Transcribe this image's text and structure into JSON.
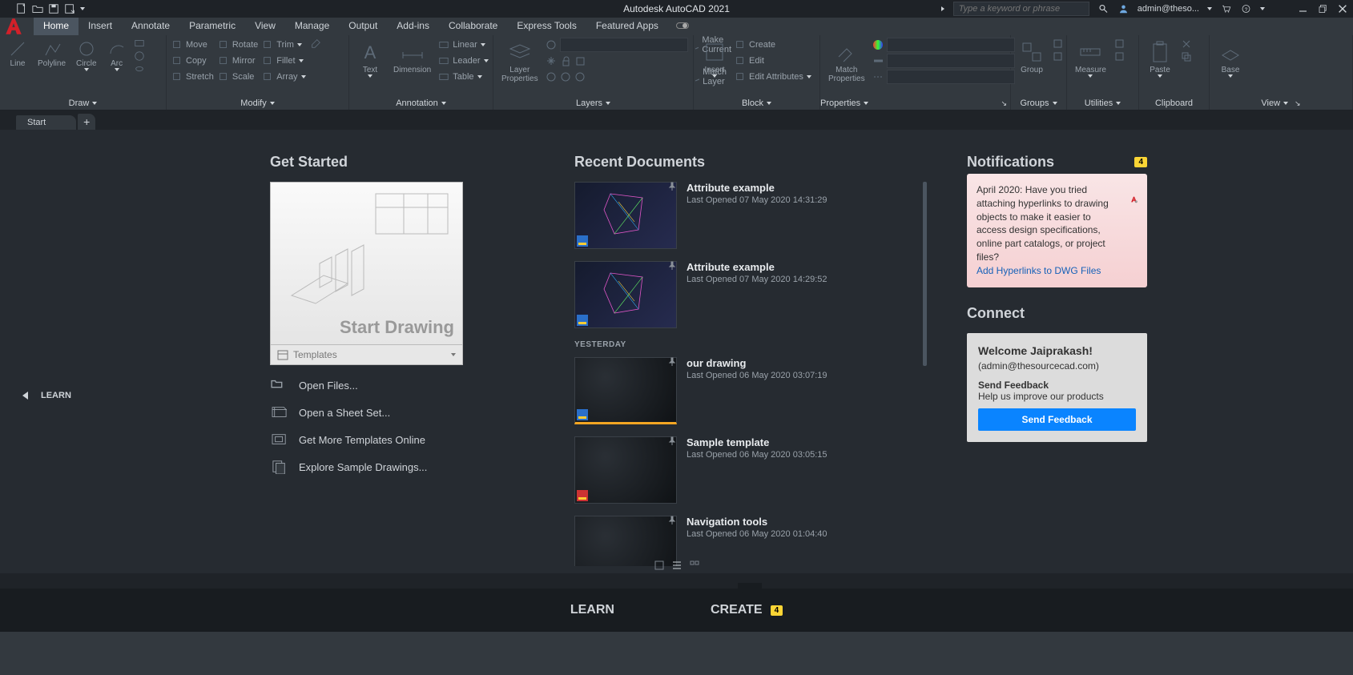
{
  "titlebar": {
    "app_title": "Autodesk AutoCAD 2021",
    "search_placeholder": "Type a keyword or phrase",
    "user": "admin@theso..."
  },
  "menu": [
    "Home",
    "Insert",
    "Annotate",
    "Parametric",
    "View",
    "Manage",
    "Output",
    "Add-ins",
    "Collaborate",
    "Express Tools",
    "Featured Apps"
  ],
  "menu_active": 0,
  "ribbon": {
    "draw": {
      "title": "Draw",
      "items": [
        "Line",
        "Polyline",
        "Circle",
        "Arc"
      ]
    },
    "modify": {
      "title": "Modify",
      "left": [
        "Move",
        "Copy",
        "Stretch"
      ],
      "mid": [
        "Rotate",
        "Mirror",
        "Scale"
      ],
      "right": [
        "Trim",
        "Fillet",
        "Array"
      ]
    },
    "annotation": {
      "title": "Annotation",
      "text": "Text",
      "dim": "Dimension",
      "items": [
        "Linear",
        "Leader",
        "Table"
      ]
    },
    "layers": {
      "title": "Layers",
      "btn": "Layer\nProperties",
      "right": [
        "Make Current",
        "Match Layer"
      ]
    },
    "block": {
      "title": "Block",
      "insert": "Insert",
      "items": [
        "Create",
        "Edit",
        "Edit Attributes"
      ],
      "mp": "Match\nProperties"
    },
    "properties": {
      "title": "Properties"
    },
    "groups": {
      "title": "Groups",
      "btn": "Group"
    },
    "utilities": {
      "title": "Utilities",
      "btn": "Measure"
    },
    "clipboard": {
      "title": "Clipboard",
      "btn": "Paste"
    },
    "view": {
      "title": "View",
      "btn": "Base"
    }
  },
  "tab": "Start",
  "learn_nav": "LEARN",
  "get_started": {
    "title": "Get Started",
    "start_drawing": "Start Drawing",
    "templates": "Templates",
    "links": [
      "Open Files...",
      "Open a Sheet Set...",
      "Get More Templates Online",
      "Explore Sample Drawings..."
    ]
  },
  "recent": {
    "title": "Recent Documents",
    "yesterday": "YESTERDAY",
    "items": [
      {
        "name": "Attribute example",
        "sub": "Last Opened 07 May 2020 14:31:29",
        "dark": false,
        "orange": false
      },
      {
        "name": "Attribute example",
        "sub": "Last Opened 07 May 2020 14:29:52",
        "dark": false,
        "orange": false
      },
      {
        "name": "our drawing",
        "sub": "Last Opened 06 May 2020 03:07:19",
        "dark": true,
        "orange": true
      },
      {
        "name": "Sample template",
        "sub": "Last Opened 06 May 2020 03:05:15",
        "dark": true,
        "orange": false
      },
      {
        "name": "Navigation tools",
        "sub": "Last Opened 06 May 2020 01:04:40",
        "dark": true,
        "orange": false
      }
    ]
  },
  "notifications": {
    "title": "Notifications",
    "count": "4",
    "body": "April 2020: Have you tried attaching hyperlinks to drawing objects to make it easier to access design specifications, online part catalogs, or project files?",
    "link": "Add Hyperlinks to DWG Files"
  },
  "connect": {
    "title": "Connect",
    "welcome": "Welcome Jaiprakash!",
    "mail": "(admin@thesourcecad.com)",
    "feedback_h": "Send Feedback",
    "feedback_t": "Help us improve our products",
    "btn": "Send Feedback"
  },
  "footer": {
    "learn": "LEARN",
    "create": "CREATE",
    "badge": "4"
  }
}
